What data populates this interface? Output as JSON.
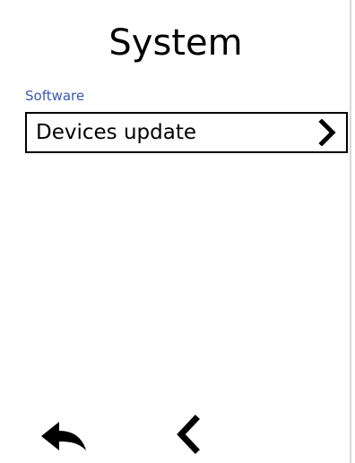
{
  "header": {
    "title": "System"
  },
  "section": {
    "label": "Software",
    "items": [
      {
        "label": "Devices update",
        "icon": "chevron-right-icon"
      }
    ]
  },
  "footer": {
    "back_icon": "reply-back-icon",
    "prev_icon": "chevron-left-icon"
  },
  "colors": {
    "section_label": "#3a57b0",
    "text": "#000000",
    "background": "#ffffff"
  }
}
